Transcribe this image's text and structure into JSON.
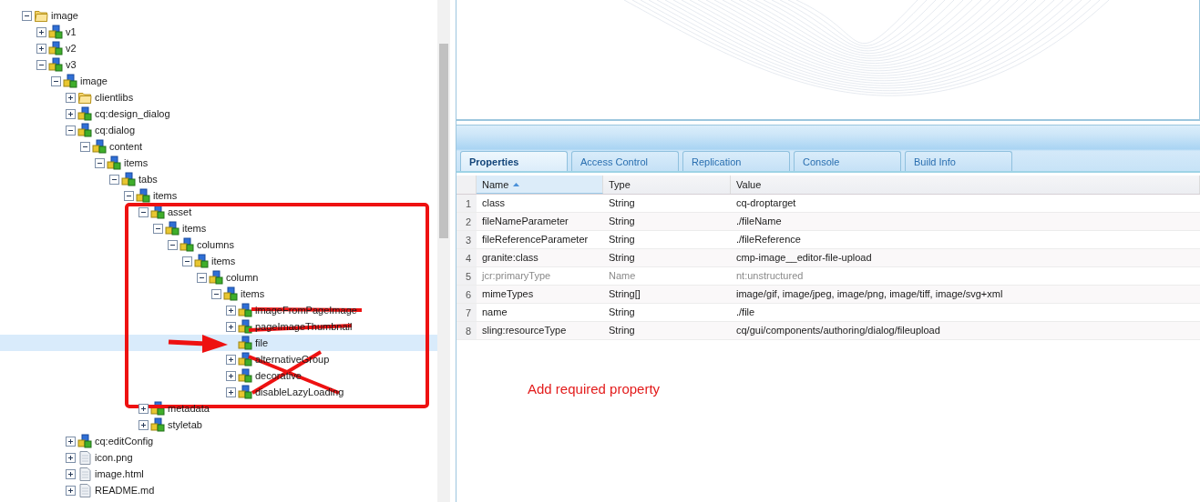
{
  "tree": [
    {
      "label": "image",
      "kind": "folder",
      "expandable": true,
      "expanded": true,
      "selected": false,
      "children": [
        {
          "label": "v1",
          "kind": "node",
          "expandable": true,
          "expanded": false,
          "selected": false
        },
        {
          "label": "v2",
          "kind": "node",
          "expandable": true,
          "expanded": false,
          "selected": false
        },
        {
          "label": "v3",
          "kind": "node",
          "expandable": true,
          "expanded": true,
          "selected": false,
          "children": [
            {
              "label": "image",
              "kind": "node",
              "expandable": true,
              "expanded": true,
              "selected": false,
              "children": [
                {
                  "label": "clientlibs",
                  "kind": "folder",
                  "expandable": true,
                  "expanded": false,
                  "selected": false
                },
                {
                  "label": "cq:design_dialog",
                  "kind": "node",
                  "expandable": true,
                  "expanded": false,
                  "selected": false
                },
                {
                  "label": "cq:dialog",
                  "kind": "node",
                  "expandable": true,
                  "expanded": true,
                  "selected": false,
                  "children": [
                    {
                      "label": "content",
                      "kind": "node",
                      "expandable": true,
                      "expanded": true,
                      "selected": false,
                      "children": [
                        {
                          "label": "items",
                          "kind": "node",
                          "expandable": true,
                          "expanded": true,
                          "selected": false,
                          "children": [
                            {
                              "label": "tabs",
                              "kind": "node",
                              "expandable": true,
                              "expanded": true,
                              "selected": false,
                              "children": [
                                {
                                  "label": "items",
                                  "kind": "node",
                                  "expandable": true,
                                  "expanded": true,
                                  "selected": false,
                                  "children": [
                                    {
                                      "label": "asset",
                                      "kind": "node",
                                      "expandable": true,
                                      "expanded": true,
                                      "selected": false,
                                      "children": [
                                        {
                                          "label": "items",
                                          "kind": "node",
                                          "expandable": true,
                                          "expanded": true,
                                          "selected": false,
                                          "children": [
                                            {
                                              "label": "columns",
                                              "kind": "node",
                                              "expandable": true,
                                              "expanded": true,
                                              "selected": false,
                                              "children": [
                                                {
                                                  "label": "items",
                                                  "kind": "node",
                                                  "expandable": true,
                                                  "expanded": true,
                                                  "selected": false,
                                                  "children": [
                                                    {
                                                      "label": "column",
                                                      "kind": "node",
                                                      "expandable": true,
                                                      "expanded": true,
                                                      "selected": false,
                                                      "children": [
                                                        {
                                                          "label": "items",
                                                          "kind": "node",
                                                          "expandable": true,
                                                          "expanded": true,
                                                          "selected": false,
                                                          "children": [
                                                            {
                                                              "label": "imageFromPageImage",
                                                              "kind": "node",
                                                              "expandable": true,
                                                              "expanded": false,
                                                              "selected": false
                                                            },
                                                            {
                                                              "label": "pageImageThumbnail",
                                                              "kind": "node",
                                                              "expandable": true,
                                                              "expanded": false,
                                                              "selected": false
                                                            },
                                                            {
                                                              "label": "file",
                                                              "kind": "node",
                                                              "expandable": false,
                                                              "selected": true
                                                            },
                                                            {
                                                              "label": "alternativeGroup",
                                                              "kind": "node",
                                                              "expandable": true,
                                                              "expanded": false,
                                                              "selected": false
                                                            },
                                                            {
                                                              "label": "decorative",
                                                              "kind": "node",
                                                              "expandable": true,
                                                              "expanded": false,
                                                              "selected": false
                                                            },
                                                            {
                                                              "label": "disableLazyLoading",
                                                              "kind": "node",
                                                              "expandable": true,
                                                              "expanded": false,
                                                              "selected": false
                                                            }
                                                          ]
                                                        }
                                                      ]
                                                    }
                                                  ]
                                                }
                                              ]
                                            }
                                          ]
                                        }
                                      ]
                                    },
                                    {
                                      "label": "metadata",
                                      "kind": "node",
                                      "expandable": true,
                                      "expanded": false,
                                      "selected": false
                                    },
                                    {
                                      "label": "styletab",
                                      "kind": "node",
                                      "expandable": true,
                                      "expanded": false,
                                      "selected": false
                                    }
                                  ]
                                }
                              ]
                            }
                          ]
                        }
                      ]
                    }
                  ]
                },
                {
                  "label": "cq:editConfig",
                  "kind": "node",
                  "expandable": true,
                  "expanded": false,
                  "selected": false
                },
                {
                  "label": "icon.png",
                  "kind": "file",
                  "expandable": true,
                  "expanded": false,
                  "selected": false
                },
                {
                  "label": "image.html",
                  "kind": "file",
                  "expandable": true,
                  "expanded": false,
                  "selected": false
                },
                {
                  "label": "README.md",
                  "kind": "file",
                  "expandable": true,
                  "expanded": false,
                  "selected": false
                }
              ]
            }
          ]
        }
      ]
    }
  ],
  "tabs": [
    {
      "label": "Properties",
      "selected": true
    },
    {
      "label": "Access Control",
      "selected": false
    },
    {
      "label": "Replication",
      "selected": false
    },
    {
      "label": "Console",
      "selected": false
    },
    {
      "label": "Build Info",
      "selected": false
    }
  ],
  "table": {
    "columns": [
      {
        "label": "Name",
        "sorted": true
      },
      {
        "label": "Type",
        "sorted": false
      },
      {
        "label": "Value",
        "sorted": false
      }
    ],
    "rows": [
      {
        "number": "1",
        "name": "class",
        "type": "String",
        "value": "cq-droptarget",
        "protected": false
      },
      {
        "number": "2",
        "name": "fileNameParameter",
        "type": "String",
        "value": "./fileName",
        "protected": false
      },
      {
        "number": "3",
        "name": "fileReferenceParameter",
        "type": "String",
        "value": "./fileReference",
        "protected": false
      },
      {
        "number": "4",
        "name": "granite:class",
        "type": "String",
        "value": "cmp-image__editor-file-upload",
        "protected": false
      },
      {
        "number": "5",
        "name": "jcr:primaryType",
        "type": "Name",
        "value": "nt:unstructured",
        "protected": true
      },
      {
        "number": "6",
        "name": "mimeTypes",
        "type": "String[]",
        "value": "image/gif, image/jpeg, image/png, image/tiff, image/svg+xml",
        "protected": false
      },
      {
        "number": "7",
        "name": "name",
        "type": "String",
        "value": "./file",
        "protected": false
      },
      {
        "number": "8",
        "name": "sling:resourceType",
        "type": "String",
        "value": "cq/gui/components/authoring/dialog/fileupload",
        "protected": false
      }
    ]
  },
  "annotation": {
    "note": "Add required property"
  }
}
